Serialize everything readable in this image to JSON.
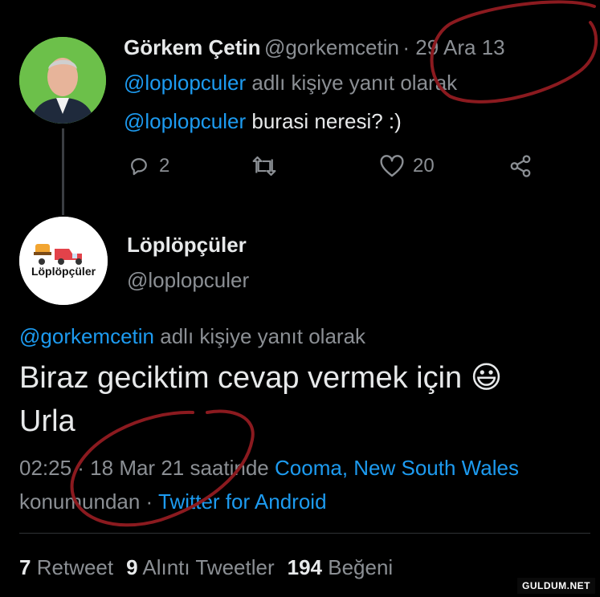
{
  "tweet1": {
    "name": "Görkem Çetin",
    "handle": "@gorkemcetin",
    "date": "· 29 Ara 13",
    "reply_mention": "@loplopculer",
    "reply_suffix": "adlı kişiye yanıt olarak",
    "body_mention": "@loplopculer",
    "body_text": "burasi neresi? :)",
    "reply_count": "2",
    "like_count": "20"
  },
  "tweet2": {
    "name": "Löplöpçüler",
    "handle": "@loplopculer",
    "avatar_text": "Löplöpçüler",
    "reply_mention": "@gorkemcetin",
    "reply_suffix": "adlı kişiye yanıt olarak",
    "body_line1": "Biraz geciktim cevap vermek için",
    "body_emoji": "😃",
    "body_line2": "Urla",
    "time": "02:25 · 18 Mar 21 saatinde",
    "location": "Cooma, New South Wales",
    "location_suffix": "konumundan ·",
    "source": "Twitter for Android",
    "retweet_count": "7",
    "retweet_label": "Retweet",
    "quote_count": "9",
    "quote_label": "Alıntı Tweetler",
    "like_count": "194",
    "like_label": "Beğeni"
  },
  "watermark": "GULDUM.NET",
  "colors": {
    "accent": "#1d9bf0",
    "annotation": "#8b1a1f"
  }
}
